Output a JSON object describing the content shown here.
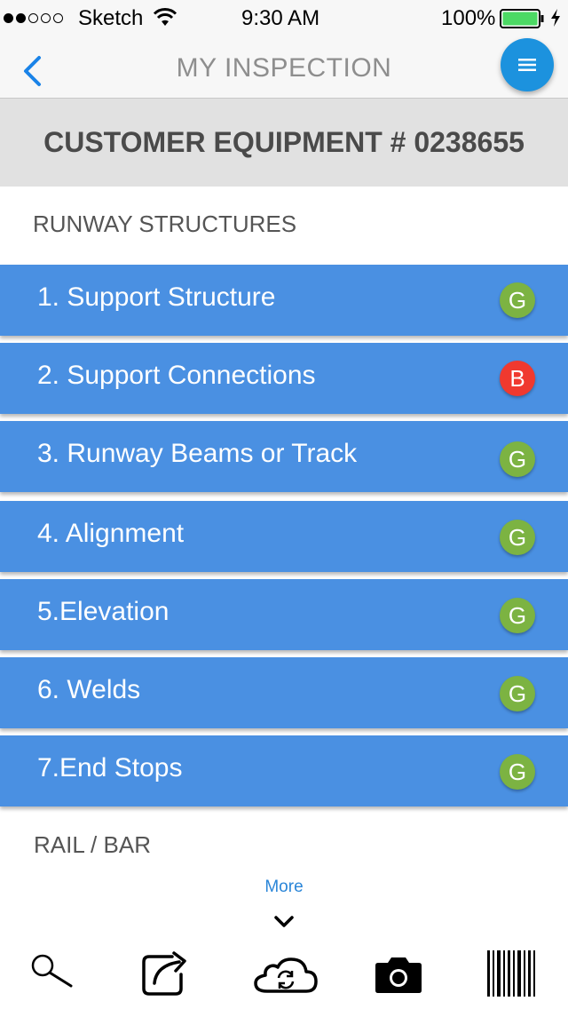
{
  "status_bar": {
    "carrier": "Sketch",
    "time": "9:30 AM",
    "battery": "100%"
  },
  "nav": {
    "title": "MY INSPECTION",
    "back_icon": "chevron-left-icon",
    "menu_icon": "menu-icon"
  },
  "customer": {
    "title": "CUSTOMER EQUIPMENT # 0238655"
  },
  "sections": {
    "runway": "RUNWAY STRUCTURES",
    "rail": "RAIL / BAR"
  },
  "items": [
    {
      "label": "1. Support Structure",
      "status": "G",
      "color": "#7cb342"
    },
    {
      "label": "2. Support Connections",
      "status": "B",
      "color": "#f0392f"
    },
    {
      "label": "3. Runway Beams or Track",
      "status": "G",
      "color": "#7cb342"
    },
    {
      "label": "4. Alignment",
      "status": "G",
      "color": "#7cb342"
    },
    {
      "label": "5.Elevation",
      "status": "G",
      "color": "#7cb342"
    },
    {
      "label": "6. Welds",
      "status": "G",
      "color": "#7cb342"
    },
    {
      "label": "7.End Stops",
      "status": "G",
      "color": "#7cb342"
    }
  ],
  "more": {
    "label": "More"
  },
  "toolbar": [
    "search-icon",
    "share-icon",
    "cloud-sync-icon",
    "camera-icon",
    "barcode-icon"
  ],
  "colors": {
    "item_bg": "#4a90e2",
    "good": "#7cb342",
    "bad": "#f0392f",
    "accent": "#1c92de"
  }
}
